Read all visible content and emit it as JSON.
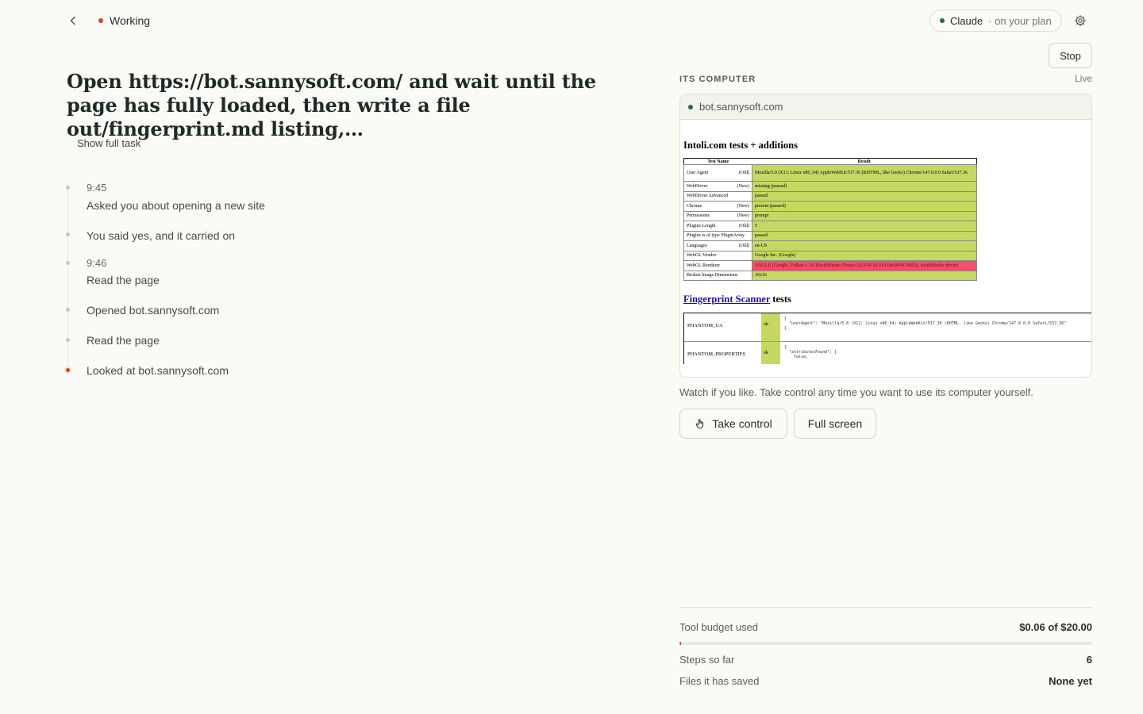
{
  "header": {
    "status_label": "Working",
    "plan_name": "Claude",
    "plan_suffix": "· on your plan"
  },
  "task": {
    "title": "Open https://bot.sannysoft.com/ and wait until the page has fully loaded, then write a file out/fingerprint.md listing,…",
    "show_full_label": "Show full task"
  },
  "timeline": [
    {
      "time": "9:45",
      "text": "Asked you about opening a new site"
    },
    {
      "time": "",
      "text": "You said yes, and it carried on"
    },
    {
      "time": "9:46",
      "text": "Read the page"
    },
    {
      "time": "",
      "text": "Opened bot.sannysoft.com"
    },
    {
      "time": "",
      "text": "Read the page"
    },
    {
      "time": "",
      "text": "Looked at bot.sannysoft.com"
    }
  ],
  "computer": {
    "stop_label": "Stop",
    "section_label": "ITS COMPUTER",
    "live_label": "Live",
    "url": "bot.sannysoft.com",
    "watch_text": "Watch if you like. Take control any time you want to use its computer yourself.",
    "take_control_label": "Take control",
    "full_screen_label": "Full screen"
  },
  "viewport": {
    "heading": "Intoli.com tests + additions",
    "col_test": "Test Name",
    "col_result": "Result",
    "rows": [
      {
        "name": "User Agent",
        "tag": "(Old)",
        "result": "Mozilla/5.0 (X11; Linux x86_64) AppleWebKit/537.36 (KHTML, like Gecko) Chrome/147.0.0.0 Safari/537.36",
        "fail": false
      },
      {
        "name": "WebDriver",
        "tag": "(New)",
        "result": "missing (passed)",
        "fail": false
      },
      {
        "name": "WebDriver Advanced",
        "tag": "",
        "result": "passed",
        "fail": false
      },
      {
        "name": "Chrome",
        "tag": "(New)",
        "result": "present (passed)",
        "fail": false
      },
      {
        "name": "Permissions",
        "tag": "(New)",
        "result": "prompt",
        "fail": false
      },
      {
        "name": "Plugins Length",
        "tag": "(Old)",
        "result": "5",
        "fail": false
      },
      {
        "name": "Plugins is of type PluginArray",
        "tag": "",
        "result": "passed",
        "fail": false
      },
      {
        "name": "Languages",
        "tag": "(Old)",
        "result": "en-US",
        "fail": false
      },
      {
        "name": "WebGL Vendor",
        "tag": "",
        "result": "Google Inc. (Google)",
        "fail": false
      },
      {
        "name": "WebGL Renderer",
        "tag": "",
        "result": "ANGLE (Google, Vulkan 1.3.0 (SwiftShader Device (LLVM 10.0.0) (0x0000C0DE)), SwiftShader driver)",
        "fail": true
      },
      {
        "name": "Broken Image Dimensions",
        "tag": "",
        "result": "16x16",
        "fail": false
      }
    ],
    "fp_link": "Fingerprint Scanner",
    "fp_suffix": " tests",
    "fp_rows": [
      {
        "name": "PHANTOM_UA",
        "status": "ok",
        "detail": "{\n  \"userAgent\": \"Mozilla/5.0 (X11; Linux x86_64) AppleWebKit/537.36 (KHTML, like Gecko) Chrome/147.0.0.0 Safari/537.36\"\n}"
      },
      {
        "name": "PHANTOM_PROPERTIES",
        "status": "ok",
        "detail": "{\n  \"attributesFound\": [\n    false,"
      }
    ]
  },
  "stats": {
    "budget_label": "Tool budget used",
    "budget_value": "$0.06 of $20.00",
    "budget_fraction": 0.003,
    "steps_label": "Steps so far",
    "steps_value": "6",
    "files_label": "Files it has saved",
    "files_value": "None yet"
  },
  "colors": {
    "accent": "#c2521c",
    "live_dot": "#1f6b4a",
    "pass": "#c6d862",
    "fail": "#f2506a"
  }
}
